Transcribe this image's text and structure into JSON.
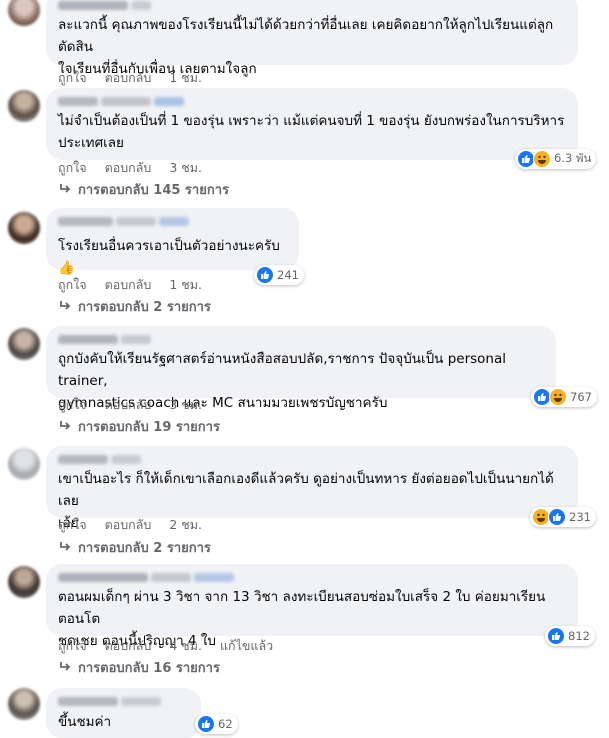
{
  "comments": [
    {
      "text": "ละแวกนี้ คุณภาพของโรงเรียนนี้ไม่ได้ด้วยกว่าที่อื่นเลย เคยคิดอยากให้ลูกไปเรียนแต่ลูกตัดสิน\nใจเรียนที่อื่นกับเพื่อน เลยตามใจลูก",
      "like": "ถูกใจ",
      "reply": "ตอบกลับ",
      "time": "1 ชม."
    },
    {
      "text": "ไม่จำเป็นต้องเป็นที่ 1 ของรุ่น เพราะว่า แม้แต่คนจบที่ 1 ของรุ่น ยังบกพร่องในการบริหาร\nประเทศเลย",
      "like": "ถูกใจ",
      "reply": "ตอบกลับ",
      "time": "3 ชม.",
      "reactions": "6.3 พัน",
      "replies": "การตอบกลับ 145 รายการ"
    },
    {
      "text": "โรงเรียนอื่นควรเอาเป็นตัวอย่างนะครับ 👍",
      "like": "ถูกใจ",
      "reply": "ตอบกลับ",
      "time": "1 ชม.",
      "reactions": "241",
      "replies": "การตอบกลับ 2 รายการ"
    },
    {
      "text": "ถูกบังคับให้เรียนรัฐศาสตร์อ่านหนังสือสอบปลัด,ราชการ ปัจจุบันเป็น personal trainer,\ngymnastics coach และ MC สนามมวยเพชรบัญชาครับ",
      "like": "ถูกใจ",
      "reply": "ตอบกลับ",
      "time": "3 ชม.",
      "reactions": "767",
      "replies": "การตอบกลับ 19 รายการ"
    },
    {
      "text": "เขาเป็นอะไร ก็ให้เด็กเขาเลือกเองดีแล้วครับ ดูอย่างเป็นทหาร ยังต่อยอดไปเป็นนายกได้เลย\nเอ้ย",
      "like": "ถูกใจ",
      "reply": "ตอบกลับ",
      "time": "2 ชม.",
      "reactions": "231",
      "replies": "การตอบกลับ 2 รายการ"
    },
    {
      "text": "ตอนผมเด็กๆ ผ่าน 3 วิชา จาก 13 วิชา ลงทะเบียนสอบซ่อมใบเสร็จ 2 ใบ ค่อยมาเรียนตอนโต\nชดเชย ตอนนี้ปริญญา 4 ใบ",
      "like": "ถูกใจ",
      "reply": "ตอบกลับ",
      "time": "4 ชม.",
      "edited": "แก้ไขแล้ว",
      "reactions": "812",
      "replies": "การตอบกลับ 16 รายการ"
    },
    {
      "text": "ขึ้นชมค่า",
      "reactions": "62"
    }
  ],
  "colors": {
    "bubble": "#f0f2f5",
    "meta": "#65676b",
    "like": "#1877f2",
    "haha": "#f7b125"
  }
}
